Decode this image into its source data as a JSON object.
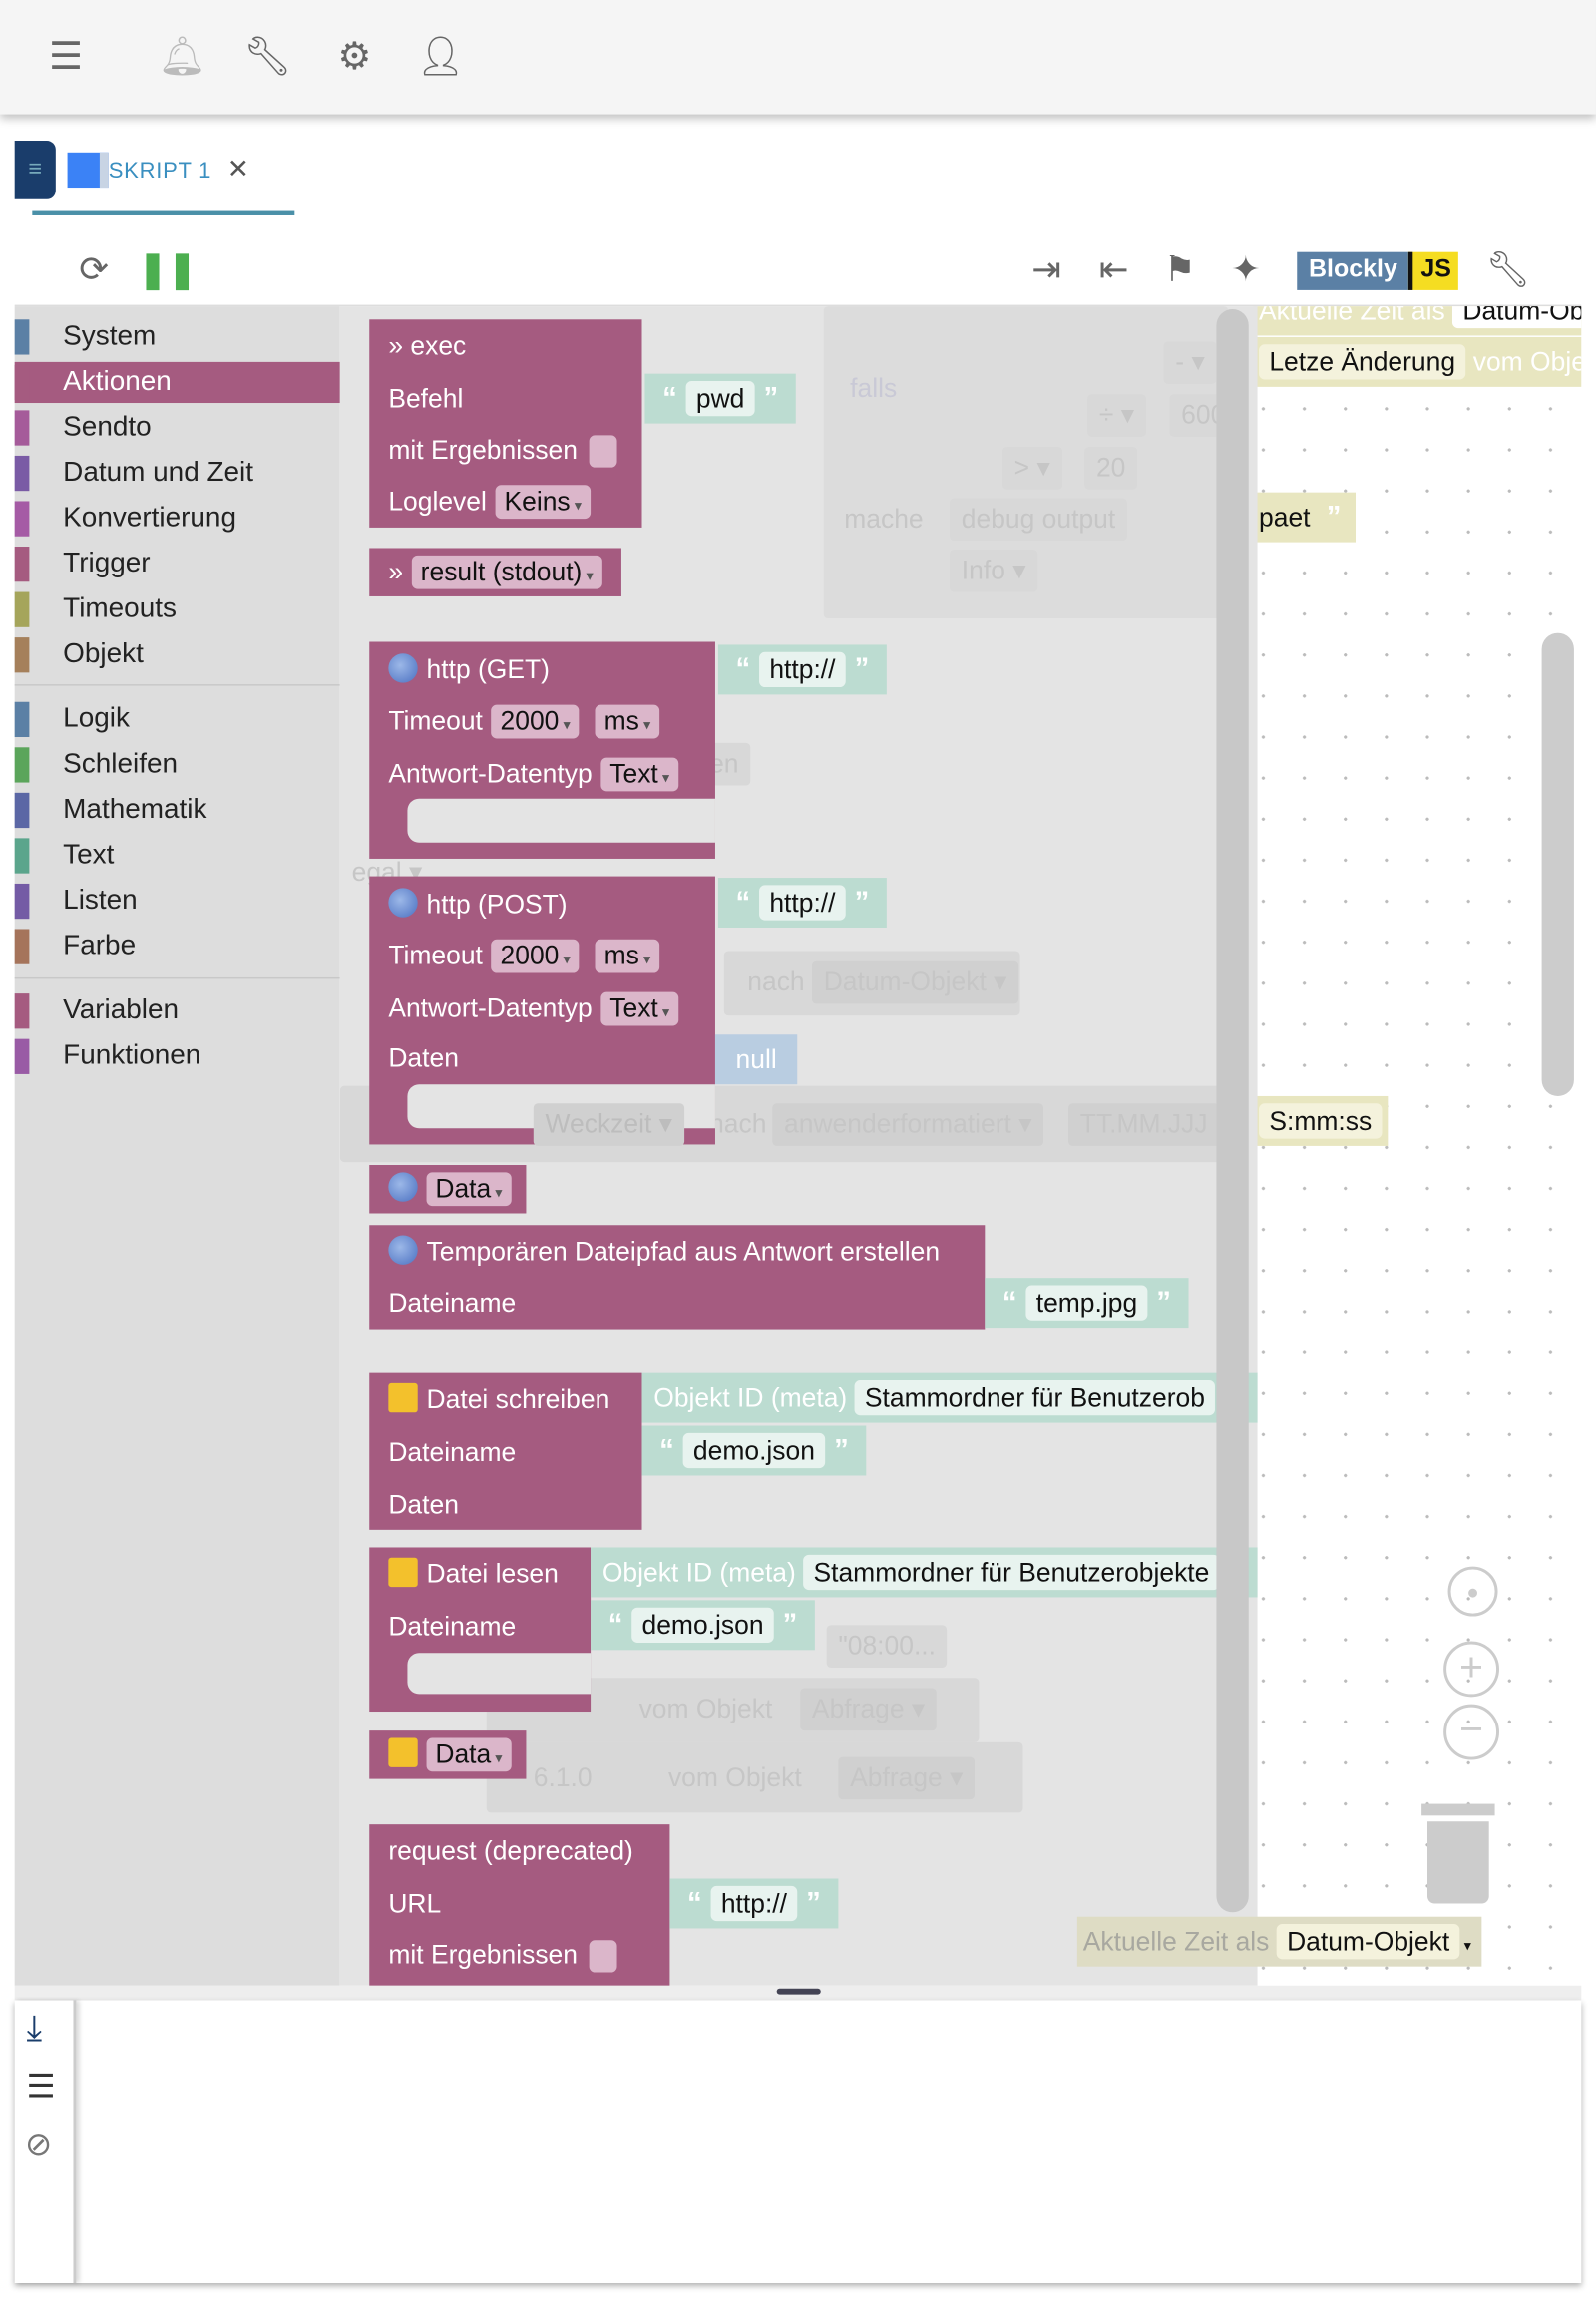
{
  "topbar": {
    "icons": [
      "menu-icon",
      "bell-icon",
      "wrench-icon",
      "gear-icon",
      "head-icon"
    ]
  },
  "tab": {
    "label": "SKRIPT 1",
    "close": "✕"
  },
  "toolbar": {
    "blockly_label": "Blockly",
    "js_label": "JS",
    "icons": [
      "refresh-icon",
      "pause-icon",
      "export-icon",
      "import-icon",
      "flag-icon",
      "sparkle-icon",
      "wrench-icon"
    ],
    "pause_color": "#4caf50"
  },
  "categories": [
    {
      "label": "System",
      "color": "#5b80a5"
    },
    {
      "label": "Aktionen",
      "color": "#a55b80",
      "selected": true
    },
    {
      "label": "Sendto",
      "color": "#a55b9a"
    },
    {
      "label": "Datum und Zeit",
      "color": "#7a5ba5"
    },
    {
      "label": "Konvertierung",
      "color": "#a55ba5"
    },
    {
      "label": "Trigger",
      "color": "#a55b80"
    },
    {
      "label": "Timeouts",
      "color": "#a5a55b"
    },
    {
      "label": "Objekt",
      "color": "#a5805b"
    },
    {
      "label": "Logik",
      "color": "#5b80a5"
    },
    {
      "label": "Schleifen",
      "color": "#5ba55b"
    },
    {
      "label": "Mathematik",
      "color": "#5b67a5"
    },
    {
      "label": "Text",
      "color": "#5ba58c"
    },
    {
      "label": "Listen",
      "color": "#745ba5"
    },
    {
      "label": "Farbe",
      "color": "#a5745b"
    },
    {
      "label": "Variablen",
      "color": "#a55b80"
    },
    {
      "label": "Funktionen",
      "color": "#995ba5"
    }
  ],
  "blocks": {
    "exec": {
      "title": "» exec",
      "befehl": "Befehl",
      "befehl_value": "pwd",
      "mit": "mit Ergebnissen",
      "loglevel": "Loglevel",
      "loglevel_value": "Keins"
    },
    "result": {
      "prefix": "»",
      "value": "result (stdout)"
    },
    "http_get": {
      "title": "http (GET)",
      "url": "http://",
      "timeout": "Timeout",
      "timeout_value": "2000",
      "unit": "ms",
      "type": "Antwort-Datentyp",
      "type_value": "Text"
    },
    "http_post": {
      "title": "http (POST)",
      "url": "http://",
      "timeout": "Timeout",
      "timeout_value": "2000",
      "unit": "ms",
      "type": "Antwort-Datentyp",
      "type_value": "Text",
      "daten": "Daten",
      "daten_value": "null"
    },
    "data1": {
      "value": "Data"
    },
    "temp": {
      "title": "Temporären Dateipfad aus Antwort erstellen",
      "dateiname": "Dateiname",
      "value": "temp.jpg"
    },
    "write": {
      "title": "Datei schreiben",
      "objekt": "Objekt ID (meta)",
      "objekt_value": "Stammordner für Benutzerob",
      "dateiname": "Dateiname",
      "value": "demo.json",
      "daten": "Daten"
    },
    "read": {
      "title": "Datei lesen",
      "objekt": "Objekt ID (meta)",
      "objekt_value": "Stammordner für Benutzerobjekte",
      "dateiname": "Dateiname",
      "value": "demo.json"
    },
    "data2": {
      "value": "Data"
    },
    "request": {
      "title": "request (deprecated)",
      "url": "URL",
      "url_value": "http://",
      "mit": "mit Ergebnissen"
    }
  },
  "ghost": {
    "falls": "falls",
    "minus": "- ▾",
    "div": "÷ ▾",
    "v600": "600",
    "gt": "> ▾",
    "v20": "20",
    "mache": "mache",
    "debug": "debug output",
    "info": "Info ▾",
    "en": "en",
    "egal": "egal ▾",
    "nach": "nach",
    "datum": "Datum-Objekt ▾",
    "weckzeit": "Weckzeit ▾",
    "nach2": "nach",
    "anwender": "anwenderformatiert ▾",
    "ttmm": "TT.MM.JJJ",
    "t0800": "\"08:00...",
    "vomobjekt": "vom Objekt",
    "abfrage": "Abfrage ▾",
    "v610": "6.1.0",
    "vomobjekt2": "vom Objekt",
    "abfrage2": "Abfrage ▾"
  },
  "workspace": {
    "aktuelle": "Aktuelle Zeit als",
    "datum_ob": "Datum-Ob",
    "letze": "Letze Änderung",
    "vom_obje": "vom Obje",
    "spaet": "paet",
    "smmss": "S:mm:ss",
    "aktuelle2": "Aktuelle Zeit als",
    "datum_objekt": "Datum-Objekt"
  },
  "log": {
    "icons": [
      "scroll-down-icon",
      "list-icon",
      "eye-off-icon"
    ]
  }
}
